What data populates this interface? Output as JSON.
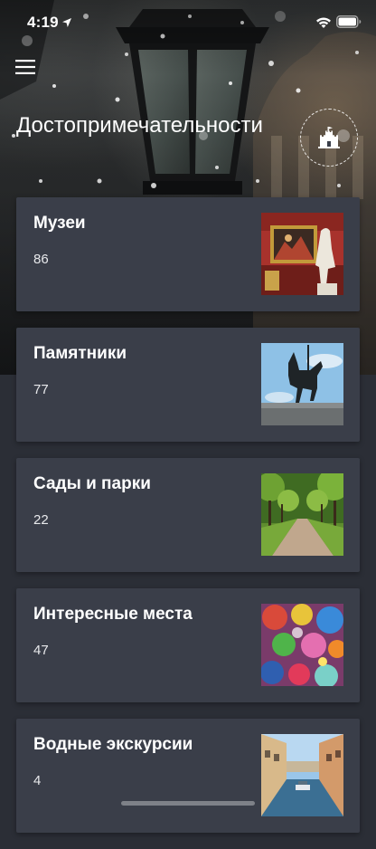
{
  "status_bar": {
    "time": "4:19",
    "icons": [
      "location-arrow-icon",
      "wifi-icon",
      "battery-icon"
    ]
  },
  "header": {
    "menu_icon": "hamburger-icon",
    "title": "Достопримечательности",
    "badge_icon": "castle-icon"
  },
  "categories": [
    {
      "title": "Музеи",
      "count": "86",
      "image": "museum-painting-photo"
    },
    {
      "title": "Памятники",
      "count": "77",
      "image": "equestrian-monument-photo"
    },
    {
      "title": "Сады и парки",
      "count": "22",
      "image": "park-alley-photo"
    },
    {
      "title": "Интересные места",
      "count": "47",
      "image": "colorful-mosaic-photo"
    },
    {
      "title": "Водные экскурсии",
      "count": "4",
      "image": "canal-boat-photo"
    }
  ],
  "colors": {
    "background": "#2b2e36",
    "card": "#3a3e49",
    "text": "#ffffff"
  }
}
